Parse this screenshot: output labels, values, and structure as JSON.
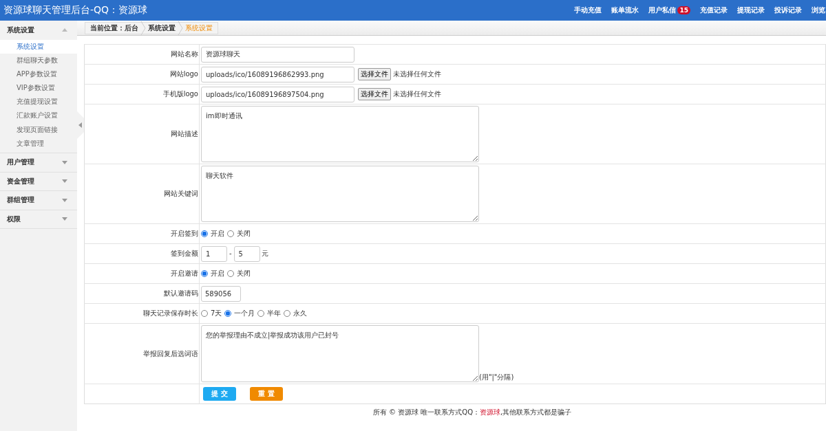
{
  "header": {
    "title": "资源球聊天管理后台-QQ：资源球",
    "nav": [
      {
        "label": "手动充值"
      },
      {
        "label": "账单流水"
      },
      {
        "label": "用户私信",
        "badge": "15"
      },
      {
        "label": "充值记录"
      },
      {
        "label": "提现记录"
      },
      {
        "label": "投诉记录"
      },
      {
        "label": "浏览"
      }
    ]
  },
  "sidebar": {
    "groups": [
      {
        "label": "系统设置",
        "expanded": true,
        "items": [
          {
            "label": "系统设置",
            "selected": true
          },
          {
            "label": "群组聊天参数",
            "selected": false
          },
          {
            "label": "APP参数设置",
            "selected": false
          },
          {
            "label": "VIP参数设置",
            "selected": false
          },
          {
            "label": "充值提现设置",
            "selected": false
          },
          {
            "label": "汇款账户设置",
            "selected": false
          },
          {
            "label": "发现页面链接",
            "selected": false
          },
          {
            "label": "文章管理",
            "selected": false
          }
        ]
      },
      {
        "label": "用户管理",
        "expanded": false
      },
      {
        "label": "资金管理",
        "expanded": false
      },
      {
        "label": "群组管理",
        "expanded": false
      },
      {
        "label": "权限",
        "expanded": false
      }
    ]
  },
  "breadcrumb": [
    {
      "label": "当前位置：后台",
      "selected": false
    },
    {
      "label": "系统设置",
      "selected": false
    },
    {
      "label": "系统设置",
      "selected": true
    }
  ],
  "form": {
    "rows": [
      {
        "kind": "text",
        "label": "网站名称",
        "value": "资源球聊天"
      },
      {
        "kind": "file",
        "label": "网站logo",
        "value": "uploads/ico/16089196862993.png",
        "button": "选择文件",
        "status": "未选择任何文件"
      },
      {
        "kind": "file",
        "label": "手机版logo",
        "value": "uploads/ico/16089196897504.png",
        "button": "选择文件",
        "status": "未选择任何文件"
      },
      {
        "kind": "textarea",
        "label": "网站描述",
        "value": "im即时通讯"
      },
      {
        "kind": "textarea",
        "label": "网站关键词",
        "value": "聊天软件"
      },
      {
        "kind": "radio",
        "label": "开启签到",
        "options": [
          {
            "label": "开启",
            "selected": true
          },
          {
            "label": "关闭",
            "selected": false
          }
        ]
      },
      {
        "kind": "range",
        "label": "签到金额",
        "min": "1",
        "separator": "-",
        "max": "5",
        "unit": "元"
      },
      {
        "kind": "radio",
        "label": "开启邀请",
        "options": [
          {
            "label": "开启",
            "selected": true
          },
          {
            "label": "关闭",
            "selected": false
          }
        ]
      },
      {
        "kind": "short",
        "label": "默认邀请码",
        "value": "589056"
      },
      {
        "kind": "radio",
        "label": "聊天记录保存时长",
        "options": [
          {
            "label": "7天",
            "selected": false
          },
          {
            "label": "一个月",
            "selected": true
          },
          {
            "label": "半年",
            "selected": false
          },
          {
            "label": "永久",
            "selected": false
          }
        ]
      },
      {
        "kind": "textarea",
        "label": "举报回复后选词语",
        "value": "您的举报理由不成立|举报成功该用户已封号",
        "note": "(用\"|\"分隔)"
      }
    ],
    "submit": "提 交",
    "reset": "重 置"
  },
  "footer": {
    "prefix": "所有 © 资源球 唯一联系方式QQ：",
    "highlight": "资源球",
    "suffix": ",其他联系方式都是骗子"
  }
}
